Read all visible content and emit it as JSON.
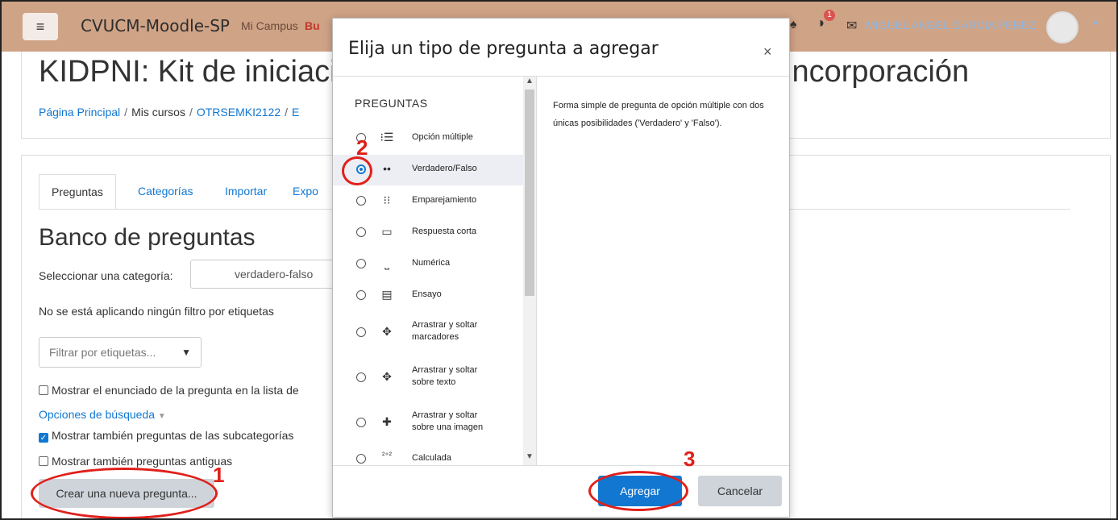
{
  "navbar": {
    "menu_icon": "hamburger-icon",
    "site_name": "CVUCM-Moodle-SP",
    "mi_campus": "Mi Campus",
    "partial_menu": "Bu",
    "notification_count": "1",
    "user_name": "MIGUEL ANGEL GARCIA PEREZ"
  },
  "page": {
    "course_title_left": "KIDPNI: Kit de iniciació",
    "course_title_right": "incorporación",
    "breadcrumb": [
      "Página Principal",
      "Mis cursos",
      "OTRSEMKI2122",
      "E"
    ]
  },
  "tabs": [
    "Preguntas",
    "Categorías",
    "Importar",
    "Expo"
  ],
  "bank": {
    "title": "Banco de preguntas",
    "category_label": "Seleccionar una categoría:",
    "category_value": "verdadero-falso",
    "no_filter_text": "No se está aplicando ningún filtro por etiquetas",
    "filter_placeholder": "Filtrar por etiquetas...",
    "show_statement": "Mostrar el enunciado de la pregunta en la lista de",
    "search_options": "Opciones de búsqueda",
    "show_subcategories": "Mostrar también preguntas de las subcategorías",
    "show_old": "Mostrar también preguntas antiguas",
    "create_button": "Crear una nueva pregunta..."
  },
  "modal": {
    "title": "Elija un tipo de pregunta a agregar",
    "close": "×",
    "section_heading": "PREGUNTAS",
    "options": [
      {
        "label": "Opción múltiple",
        "icon": "list-icon",
        "glyph": "⁝☰"
      },
      {
        "label": "Verdadero/Falso",
        "icon": "dots-icon",
        "glyph": "••",
        "selected": true
      },
      {
        "label": "Emparejamiento",
        "icon": "match-icon",
        "glyph": "⁝⁝"
      },
      {
        "label": "Respuesta corta",
        "icon": "textbox-icon",
        "glyph": "▭"
      },
      {
        "label": "Numérica",
        "icon": "numeric-icon",
        "glyph": "⎵"
      },
      {
        "label": "Ensayo",
        "icon": "document-icon",
        "glyph": "▤"
      },
      {
        "label": "Arrastrar y soltar marcadores",
        "icon": "move-markers-icon",
        "glyph": "✥"
      },
      {
        "label": "Arrastrar y soltar sobre texto",
        "icon": "move-text-icon",
        "glyph": "✥"
      },
      {
        "label": "Arrastrar y soltar sobre una imagen",
        "icon": "move-image-icon",
        "glyph": "✚"
      },
      {
        "label": "Calculada",
        "icon": "calculated-icon",
        "glyph": "²⁺²"
      }
    ],
    "description": "Forma simple de pregunta de opción múltiple con dos únicas posibilidades ('Verdadero' y 'Falso').",
    "add_button": "Agregar",
    "cancel_button": "Cancelar"
  },
  "annotations": [
    "1",
    "2",
    "3"
  ],
  "colors": {
    "navbar": "#cfa386",
    "link": "#1177d1",
    "annotation": "#e0201a"
  }
}
